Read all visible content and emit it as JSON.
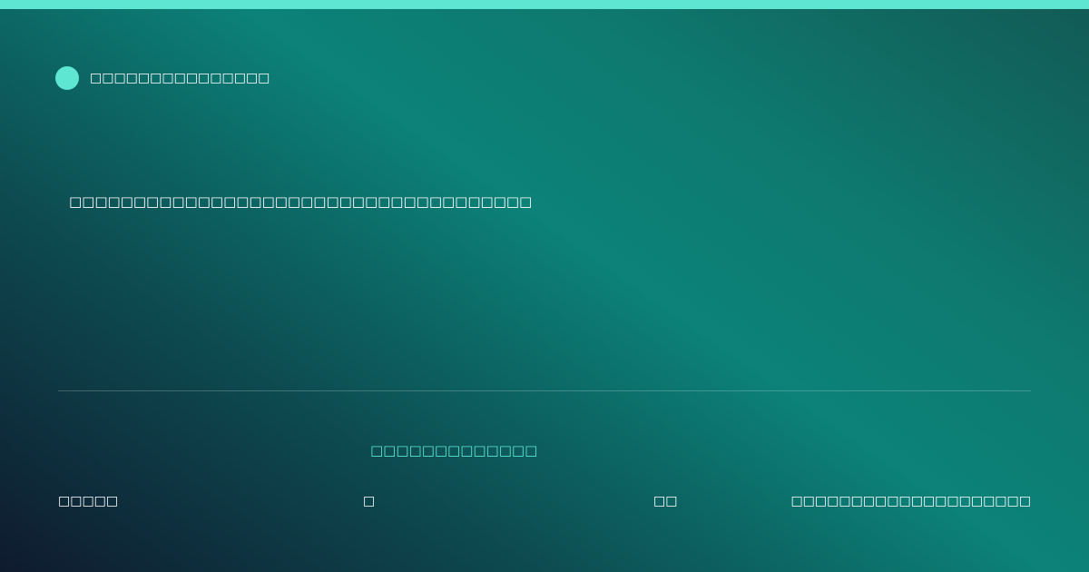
{
  "brand": {
    "name": "□□□□□□□□□□□□□□□",
    "accent_color": "#5ee6d2"
  },
  "headline": "□□□□□□□□□□□□□□□□□□□□□□□□□□□□□□□□□□□□",
  "accent_text": "□□□□□□□□□□□□□",
  "footer": {
    "item_1": "□□□□□",
    "item_2": "□",
    "item_3": "□□",
    "item_4": "□□□□□□□□□□□□□□□□□□□□"
  }
}
